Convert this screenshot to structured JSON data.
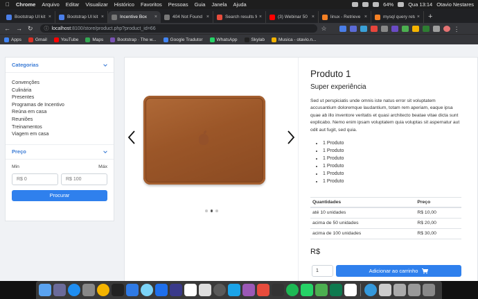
{
  "menubar": {
    "app": "Chrome",
    "items": [
      "Arquivo",
      "Editar",
      "Visualizar",
      "Histórico",
      "Favoritos",
      "Pessoas",
      "Guia",
      "Janela",
      "Ajuda"
    ],
    "battery": "64%",
    "clock": "Qua 13:14",
    "user": "Otavio Nestares"
  },
  "tabs": [
    {
      "title": "Bootstrap UI kit",
      "color": "#4a7ee8"
    },
    {
      "title": "Bootstrap UI kit",
      "color": "#4a7ee8"
    },
    {
      "title": "Incentive Box",
      "color": "#777777"
    },
    {
      "title": "404 Not Found",
      "color": "#777777"
    },
    {
      "title": "Search results fo",
      "color": "#e74c3c"
    },
    {
      "title": "(3) Webinar 50",
      "color": "#ff0000"
    },
    {
      "title": "linux - Retrieve",
      "color": "#f48024"
    },
    {
      "title": "mysql query retu",
      "color": "#f48024"
    }
  ],
  "active_tab": 2,
  "omnibox": {
    "host": "localhost",
    "path": ":8100/store/product.php?product_id=66"
  },
  "bookmarks": [
    {
      "label": "Apps",
      "color": "#4285f4"
    },
    {
      "label": "Gmail",
      "color": "#d93025"
    },
    {
      "label": "YouTube",
      "color": "#ff0000"
    },
    {
      "label": "Maps",
      "color": "#34a853"
    },
    {
      "label": "Bootstrap · The w...",
      "color": "#7952b3"
    },
    {
      "label": "Google Tradutor",
      "color": "#4285f4"
    },
    {
      "label": "WhatsApp",
      "color": "#25d366"
    },
    {
      "label": "Skylab",
      "color": "#222222"
    },
    {
      "label": "Musica - otavio.n...",
      "color": "#f4b400"
    }
  ],
  "sidebar": {
    "categories_title": "Categorias",
    "categories": [
      "Convenções",
      "Culinária",
      "Presentes",
      "Programas de Incentivo",
      "Reúna em casa",
      "Reuniões",
      "Treinamentos",
      "Viagem em casa"
    ],
    "price_title": "Preço",
    "min_label": "Min",
    "max_label": "Máx",
    "min_placeholder": "R$ 0",
    "max_placeholder": "R$ 100",
    "search_button": "Procurar"
  },
  "product": {
    "title": "Produto 1",
    "subtitle": "Super experiência",
    "description": "Sed ut perspiciatis unde omnis iste natus error sit voluptatem accusantium doloremque laudantium, totam rem aperiam, eaque ipsa quae ab illo inventore veritatis et quasi architecto beatae vitae dicta sunt explicabo. Nemo enim ipsam voluptatem quia voluptas sit aspernatur aut odit aut fugit, sed quia.",
    "bullets": [
      "1 Produto",
      "1 Produto",
      "1 Produto",
      "1 Produto",
      "1 Produto",
      "1 Produto"
    ],
    "table": {
      "headers": [
        "Quantidades",
        "Preço"
      ],
      "rows": [
        [
          "até 10 unidades",
          "R$ 10,00"
        ],
        [
          "acima de 50 unidades",
          "R$ 20,00"
        ],
        [
          "acima de 100 unidades",
          "R$ 30,00"
        ]
      ]
    },
    "price": "R$",
    "quantity": "1",
    "cart_button": "Adicionar ao carrinho",
    "carousel_active": 1,
    "carousel_count": 3
  },
  "colors": {
    "primary": "#2f80ed",
    "sleeve": "#9b5628",
    "accent_link": "#3a7bd5"
  },
  "dock_colors": [
    "#5aa3f0",
    "#6b6b9a",
    "#1f8ef1",
    "#888888",
    "#f4b400",
    "#222222",
    "#2f7ae5",
    "#7bd3f7",
    "#1f6feb",
    "#3a3a8a",
    "#ffffff",
    "#dddddd",
    "#5a5a5a",
    "#1aa3e8",
    "#9b59b6",
    "#e74c3c",
    "#333333",
    "#1db954",
    "#25d366",
    "#4caf50",
    "#0f7a4f",
    "#ffffff",
    "#3498db",
    "#cccccc",
    "#aaaaaa",
    "#999999",
    "#888888"
  ]
}
